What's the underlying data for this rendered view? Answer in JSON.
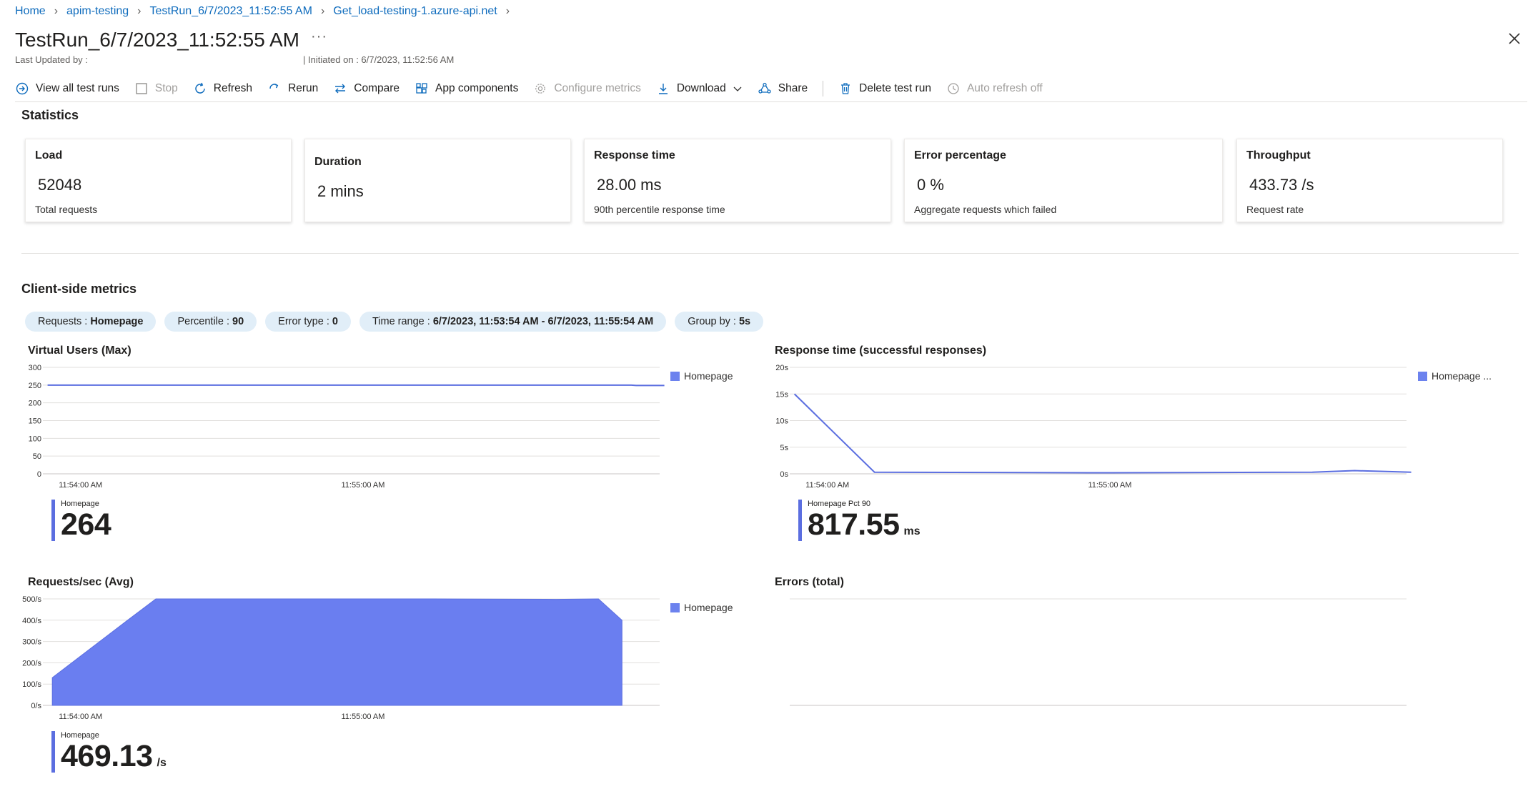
{
  "breadcrumb": [
    "Home",
    "apim-testing",
    "TestRun_6/7/2023_11:52:55 AM",
    "Get_load-testing-1.azure-api.net"
  ],
  "title": "TestRun_6/7/2023_11:52:55 AM",
  "ellipsis": "···",
  "last_updated": "Last Updated by :",
  "initiated": "| Initiated on : 6/7/2023, 11:52:56 AM",
  "toolbar": {
    "view_all": "View all test runs",
    "stop": "Stop",
    "refresh": "Refresh",
    "rerun": "Rerun",
    "compare": "Compare",
    "app_components": "App components",
    "configure_metrics": "Configure metrics",
    "download": "Download",
    "share": "Share",
    "delete": "Delete test run",
    "auto_refresh": "Auto refresh off"
  },
  "statistics": {
    "title": "Statistics",
    "cards": [
      {
        "label": "Load",
        "value": "52048",
        "sub": "Total requests"
      },
      {
        "label": "Duration",
        "value": "2 mins",
        "sub": ""
      },
      {
        "label": "Response time",
        "value": "28.00 ms",
        "sub": "90th percentile response time"
      },
      {
        "label": "Error percentage",
        "value": "0 %",
        "sub": "Aggregate requests which failed"
      },
      {
        "label": "Throughput",
        "value": "433.73 /s",
        "sub": "Request rate"
      }
    ]
  },
  "client_metrics": {
    "title": "Client-side metrics",
    "pills": [
      {
        "key": "Requests :",
        "val": "Homepage"
      },
      {
        "key": "Percentile :",
        "val": "90"
      },
      {
        "key": "Error type :",
        "val": "0"
      },
      {
        "key": "Time range :",
        "val": "6/7/2023, 11:53:54 AM - 6/7/2023, 11:55:54 AM"
      },
      {
        "key": "Group by :",
        "val": "5s"
      }
    ]
  },
  "colors": {
    "accent": "#0f6cbd",
    "series": "#6c82ee",
    "pill_bg": "#e1eef8"
  },
  "chart_data": [
    {
      "type": "line",
      "title": "Virtual Users (Max)",
      "legend": "Homepage",
      "x_ticks": [
        "11:54:00 AM",
        "11:55:00 AM"
      ],
      "y_ticks": [
        "0",
        "50",
        "100",
        "150",
        "200",
        "250",
        "300"
      ],
      "ylim": [
        0,
        300
      ],
      "x_range_seconds": [
        -8,
        123
      ],
      "series": [
        {
          "name": "Homepage",
          "points": [
            [
              -7,
              250
            ],
            [
              117,
              250
            ],
            [
              118,
              249
            ],
            [
              124,
              249
            ]
          ]
        }
      ],
      "summary_label": "Homepage",
      "summary_value": "264",
      "summary_unit": ""
    },
    {
      "type": "line",
      "title": "Response time (successful responses)",
      "legend": "Homepage ...",
      "x_ticks": [
        "11:54:00 AM",
        "11:55:00 AM"
      ],
      "y_ticks": [
        "0s",
        "5s",
        "10s",
        "15s",
        "20s"
      ],
      "ylim": [
        0,
        20
      ],
      "x_range_seconds": [
        -8,
        123
      ],
      "series": [
        {
          "name": "Homepage ...",
          "points": [
            [
              -7,
              15
            ],
            [
              10,
              0.3
            ],
            [
              60,
              0.2
            ],
            [
              103,
              0.3
            ],
            [
              112,
              0.6
            ],
            [
              124,
              0.3
            ]
          ]
        }
      ],
      "summary_label": "Homepage Pct 90",
      "summary_value": "817.55",
      "summary_unit": "ms"
    },
    {
      "type": "area",
      "title": "Requests/sec (Avg)",
      "legend": "Homepage",
      "x_ticks": [
        "11:54:00 AM",
        "11:55:00 AM"
      ],
      "y_ticks": [
        "0/s",
        "100/s",
        "200/s",
        "300/s",
        "400/s",
        "500/s"
      ],
      "ylim": [
        0,
        500
      ],
      "x_range_seconds": [
        -8,
        123
      ],
      "series": [
        {
          "name": "Homepage",
          "points": [
            [
              -6,
              130
            ],
            [
              10,
              400
            ],
            [
              16,
              500
            ],
            [
              45,
              500
            ],
            [
              75,
              500
            ],
            [
              101,
              498
            ],
            [
              110,
              500
            ],
            [
              115,
              400
            ]
          ]
        }
      ],
      "summary_label": "Homepage",
      "summary_value": "469.13",
      "summary_unit": "/s"
    },
    {
      "type": "line",
      "title": "Errors (total)",
      "legend": "",
      "x_ticks": [],
      "y_ticks": [],
      "series": []
    }
  ]
}
